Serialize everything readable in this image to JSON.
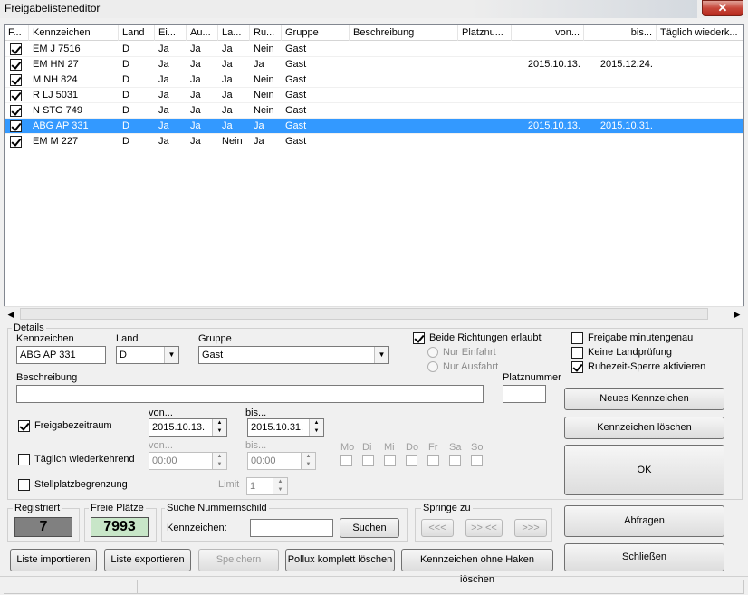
{
  "window": {
    "title": "Freigabelisteneditor"
  },
  "list": {
    "columns": [
      "F...",
      "Kennzeichen",
      "Land",
      "Ei...",
      "Au...",
      "La...",
      "Ru...",
      "Gruppe",
      "Beschreibung",
      "Platznu...",
      "von...",
      "bis...",
      "Täglich wiederk..."
    ],
    "rows": [
      {
        "checked": true,
        "kennzeichen": "EM J 7516",
        "land": "D",
        "ei": "Ja",
        "au": "Ja",
        "la": "Ja",
        "ru": "Nein",
        "gruppe": "Gast",
        "beschreibung": "",
        "platz": "",
        "von": "",
        "bis": "",
        "taeglich": "",
        "selected": false
      },
      {
        "checked": true,
        "kennzeichen": "EM HN 27",
        "land": "D",
        "ei": "Ja",
        "au": "Ja",
        "la": "Ja",
        "ru": "Ja",
        "gruppe": "Gast",
        "beschreibung": "",
        "platz": "",
        "von": "2015.10.13.",
        "bis": "2015.12.24.",
        "taeglich": "",
        "selected": false
      },
      {
        "checked": true,
        "kennzeichen": "M NH 824",
        "land": "D",
        "ei": "Ja",
        "au": "Ja",
        "la": "Ja",
        "ru": "Nein",
        "gruppe": "Gast",
        "beschreibung": "",
        "platz": "",
        "von": "",
        "bis": "",
        "taeglich": "",
        "selected": false
      },
      {
        "checked": true,
        "kennzeichen": "R LJ 5031",
        "land": "D",
        "ei": "Ja",
        "au": "Ja",
        "la": "Ja",
        "ru": "Nein",
        "gruppe": "Gast",
        "beschreibung": "",
        "platz": "",
        "von": "",
        "bis": "",
        "taeglich": "",
        "selected": false
      },
      {
        "checked": true,
        "kennzeichen": "N STG 749",
        "land": "D",
        "ei": "Ja",
        "au": "Ja",
        "la": "Ja",
        "ru": "Nein",
        "gruppe": "Gast",
        "beschreibung": "",
        "platz": "",
        "von": "",
        "bis": "",
        "taeglich": "",
        "selected": false
      },
      {
        "checked": true,
        "kennzeichen": "ABG AP 331",
        "land": "D",
        "ei": "Ja",
        "au": "Ja",
        "la": "Ja",
        "ru": "Ja",
        "gruppe": "Gast",
        "beschreibung": "",
        "platz": "",
        "von": "2015.10.13.",
        "bis": "2015.10.31.",
        "taeglich": "",
        "selected": true
      },
      {
        "checked": true,
        "kennzeichen": "EM M 227",
        "land": "D",
        "ei": "Ja",
        "au": "Ja",
        "la": "Nein",
        "ru": "Ja",
        "gruppe": "Gast",
        "beschreibung": "",
        "platz": "",
        "von": "",
        "bis": "",
        "taeglich": "",
        "selected": false
      }
    ]
  },
  "details": {
    "group_label": "Details",
    "kennzeichen_label": "Kennzeichen",
    "kennzeichen_value": "ABG AP 331",
    "land_label": "Land",
    "land_value": "D",
    "gruppe_label": "Gruppe",
    "gruppe_value": "Gast",
    "beschreibung_label": "Beschreibung",
    "beschreibung_value": "",
    "platznummer_label": "Platznummer",
    "platznummer_value": "",
    "beide_richtungen": {
      "label": "Beide Richtungen erlaubt",
      "checked": true
    },
    "nur_einfahrt": "Nur Einfahrt",
    "nur_ausfahrt": "Nur Ausfahrt",
    "freigabe_minutengenau": {
      "label": "Freigabe minutengenau",
      "checked": false
    },
    "keine_landpruefung": {
      "label": "Keine Landprüfung",
      "checked": false
    },
    "ruhezeit_sperre": {
      "label": "Ruhezeit-Sperre aktivieren",
      "checked": true
    },
    "freigabezeitraum": {
      "label": "Freigabezeitraum",
      "checked": true
    },
    "von_label": "von...",
    "von_value": "2015.10.13.",
    "bis_label": "bis...",
    "bis_value": "2015.10.31.",
    "taeglich": {
      "label": "Täglich wiederkehrend",
      "checked": false
    },
    "time_von_label": "von...",
    "time_von_value": "00:00",
    "time_bis_label": "bis...",
    "time_bis_value": "00:00",
    "weekdays": [
      "Mo",
      "Di",
      "Mi",
      "Do",
      "Fr",
      "Sa",
      "So"
    ],
    "stellplatz": {
      "label": "Stellplatzbegrenzung",
      "checked": false
    },
    "limit_label": "Limit",
    "limit_value": "1"
  },
  "buttons": {
    "neues_kennzeichen": "Neues Kennzeichen",
    "kennzeichen_loeschen": "Kennzeichen löschen",
    "ok": "OK",
    "abfragen": "Abfragen",
    "schliessen": "Schließen",
    "liste_importieren": "Liste importieren",
    "liste_exportieren": "Liste exportieren",
    "speichern": "Speichern",
    "pollux_loeschen": "Pollux komplett löschen",
    "ohne_haken_loeschen": "Kennzeichen ohne Haken löschen"
  },
  "stats": {
    "registriert_label": "Registriert",
    "registriert_value": "7",
    "freie_label": "Freie Plätze",
    "freie_value": "7993"
  },
  "suche": {
    "group_label": "Suche Nummernschild",
    "kennzeichen_label": "Kennzeichen:",
    "value": "",
    "button": "Suchen"
  },
  "springe": {
    "group_label": "Springe zu",
    "first": "<<<",
    "middle": ">>.<<",
    "last": ">>>"
  },
  "colors": {
    "selection": "#3399ff",
    "lcd_gray": "#808080",
    "lcd_green": "#c8e6c8",
    "close": "#c7473a"
  }
}
